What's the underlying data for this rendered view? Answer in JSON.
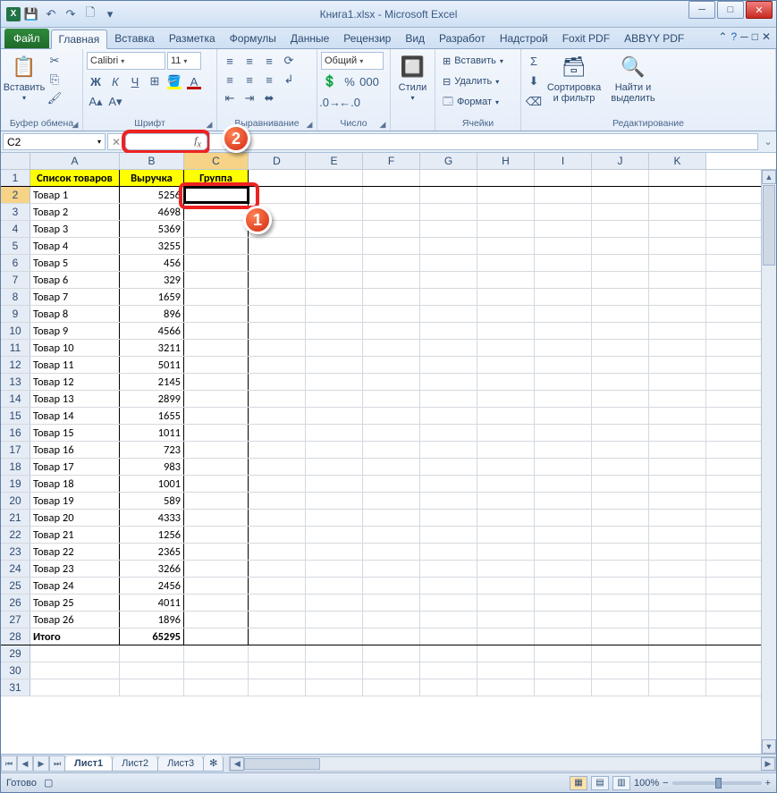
{
  "title": "Книга1.xlsx - Microsoft Excel",
  "qat": {
    "save": "💾",
    "undo": "↶",
    "redo": "↷",
    "preview": "🗋",
    "touch": "☷"
  },
  "tabs": {
    "file": "Файл",
    "items": [
      "Главная",
      "Вставка",
      "Разметка",
      "Формулы",
      "Данные",
      "Рецензир",
      "Вид",
      "Разработ",
      "Надстрой",
      "Foxit PDF",
      "ABBYY PDF"
    ],
    "active": 0
  },
  "ribbon": {
    "clipboard": {
      "label": "Буфер обмена",
      "paste": "Вставить"
    },
    "font": {
      "label": "Шрифт",
      "name": "Calibri",
      "size": "11"
    },
    "alignment": {
      "label": "Выравнивание"
    },
    "number": {
      "label": "Число",
      "format": "Общий"
    },
    "styles": {
      "label": "—",
      "btn": "Стили"
    },
    "cells": {
      "label": "Ячейки",
      "insert": "Вставить",
      "delete": "Удалить",
      "format": "Формат"
    },
    "editing": {
      "label": "Редактирование",
      "sort": "Сортировка и фильтр",
      "find": "Найти и выделить"
    }
  },
  "namebox": "C2",
  "formula": "",
  "callouts": {
    "fx": "2",
    "cell": "1"
  },
  "columns": [
    "A",
    "B",
    "C",
    "D",
    "E",
    "F",
    "G",
    "H",
    "I",
    "J",
    "K"
  ],
  "headers": {
    "a": "Список товаров",
    "b": "Выручка",
    "c": "Группа"
  },
  "rows": [
    {
      "a": "Товар 1",
      "b": "5256"
    },
    {
      "a": "Товар 2",
      "b": "4698"
    },
    {
      "a": "Товар 3",
      "b": "5369"
    },
    {
      "a": "Товар 4",
      "b": "3255"
    },
    {
      "a": "Товар 5",
      "b": "456"
    },
    {
      "a": "Товар 6",
      "b": "329"
    },
    {
      "a": "Товар 7",
      "b": "1659"
    },
    {
      "a": "Товар 8",
      "b": "896"
    },
    {
      "a": "Товар 9",
      "b": "4566"
    },
    {
      "a": "Товар 10",
      "b": "3211"
    },
    {
      "a": "Товар 11",
      "b": "5011"
    },
    {
      "a": "Товар 12",
      "b": "2145"
    },
    {
      "a": "Товар 13",
      "b": "2899"
    },
    {
      "a": "Товар 14",
      "b": "1655"
    },
    {
      "a": "Товар 15",
      "b": "1011"
    },
    {
      "a": "Товар 16",
      "b": "723"
    },
    {
      "a": "Товар 17",
      "b": "983"
    },
    {
      "a": "Товар 18",
      "b": "1001"
    },
    {
      "a": "Товар 19",
      "b": "589"
    },
    {
      "a": "Товар 20",
      "b": "4333"
    },
    {
      "a": "Товар 21",
      "b": "1256"
    },
    {
      "a": "Товар 22",
      "b": "2365"
    },
    {
      "a": "Товар 23",
      "b": "3266"
    },
    {
      "a": "Товар 24",
      "b": "2456"
    },
    {
      "a": "Товар 25",
      "b": "4011"
    },
    {
      "a": "Товар 26",
      "b": "1896"
    }
  ],
  "total": {
    "a": "Итого",
    "b": "65295"
  },
  "sheets": {
    "items": [
      "Лист1",
      "Лист2",
      "Лист3"
    ],
    "active": 0
  },
  "status": {
    "ready": "Готово",
    "zoom": "100%"
  }
}
